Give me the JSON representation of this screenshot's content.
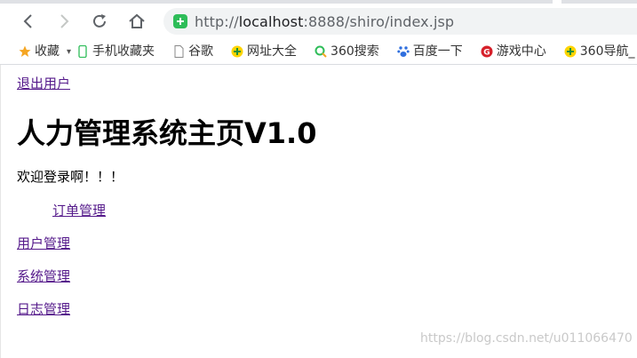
{
  "browser": {
    "url_scheme": "http://",
    "url_host": "localhost",
    "url_rest": ":8888/shiro/index.jsp"
  },
  "bookmarks": [
    {
      "label": "收藏",
      "icon": "star-icon"
    },
    {
      "label": "手机收藏夹",
      "icon": "phone-icon"
    },
    {
      "label": "谷歌",
      "icon": "page-icon"
    },
    {
      "label": "网址大全",
      "icon": "globe-icon"
    },
    {
      "label": "360搜索",
      "icon": "search-icon"
    },
    {
      "label": "百度一下",
      "icon": "paw-icon"
    },
    {
      "label": "游戏中心",
      "icon": "game-icon"
    },
    {
      "label": "360导航_",
      "icon": "globe-icon"
    }
  ],
  "page": {
    "logout_label": "退出用户",
    "title": "人力管理系统主页V1.0",
    "welcome": "欢迎登录啊！！！",
    "nav": [
      "订单管理",
      "用户管理",
      "系统管理",
      "日志管理"
    ]
  },
  "watermark": "https://blog.csdn.net/u011066470",
  "colors": {
    "link": "#551a8b",
    "address_bg": "#f1f3f4",
    "shield": "#2ebd59"
  }
}
